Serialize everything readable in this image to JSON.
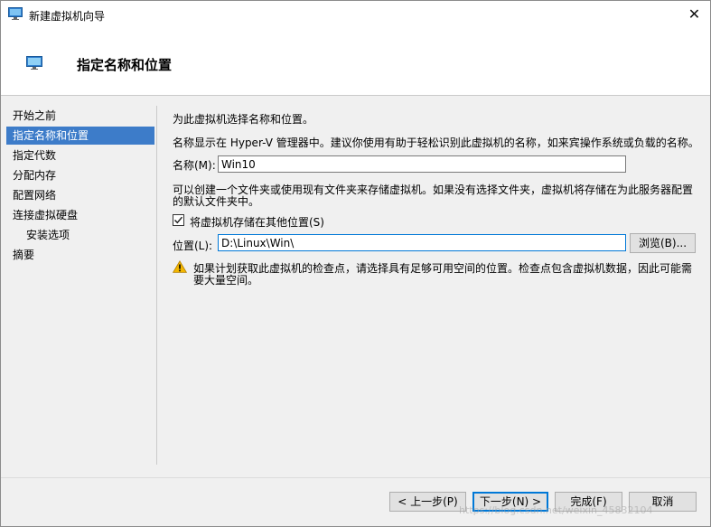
{
  "window": {
    "title": "新建虚拟机向导",
    "close_symbol": "✕"
  },
  "header": {
    "title": "指定名称和位置"
  },
  "sidebar": {
    "items": [
      {
        "label": "开始之前",
        "active": false,
        "sub": false
      },
      {
        "label": "指定名称和位置",
        "active": true,
        "sub": false
      },
      {
        "label": "指定代数",
        "active": false,
        "sub": false
      },
      {
        "label": "分配内存",
        "active": false,
        "sub": false
      },
      {
        "label": "配置网络",
        "active": false,
        "sub": false
      },
      {
        "label": "连接虚拟硬盘",
        "active": false,
        "sub": false
      },
      {
        "label": "安装选项",
        "active": false,
        "sub": true
      },
      {
        "label": "摘要",
        "active": false,
        "sub": false
      }
    ]
  },
  "main": {
    "intro": "为此虚拟机选择名称和位置。",
    "name_hint": "名称显示在 Hyper-V 管理器中。建议你使用有助于轻松识别此虚拟机的名称，如来宾操作系统或负载的名称。",
    "name_label": "名称(M):",
    "name_value": "Win10",
    "folder_hint_line1": "可以创建一个文件夹或使用现有文件夹来存储虚拟机。如果没有选择文件夹，虚拟机将存储在为此服务器配置",
    "folder_hint_line2": "的默认文件夹中。",
    "store_checkbox_label": "将虚拟机存储在其他位置(S)",
    "store_checkbox_checked": true,
    "location_label": "位置(L):",
    "location_value": "D:\\Linux\\Win\\",
    "browse_label": "浏览(B)...",
    "warning_line1": "如果计划获取此虚拟机的检查点，请选择具有足够可用空间的位置。检查点包含虚拟机数据，因此可能需",
    "warning_line2": "要大量空间。"
  },
  "footer": {
    "prev_label": "< 上一步(P)",
    "next_label": "下一步(N) >",
    "finish_label": "完成(F)",
    "cancel_label": "取消"
  },
  "watermark": "https://blog.csdn.net/weixin_45832104",
  "colors": {
    "accent": "#0078d7",
    "selected": "#3d7cc9",
    "warning": "#f2b600"
  },
  "icons": {
    "window": "monitor-icon",
    "header": "monitor-icon",
    "warning": "warning-icon",
    "check": "check-icon"
  }
}
